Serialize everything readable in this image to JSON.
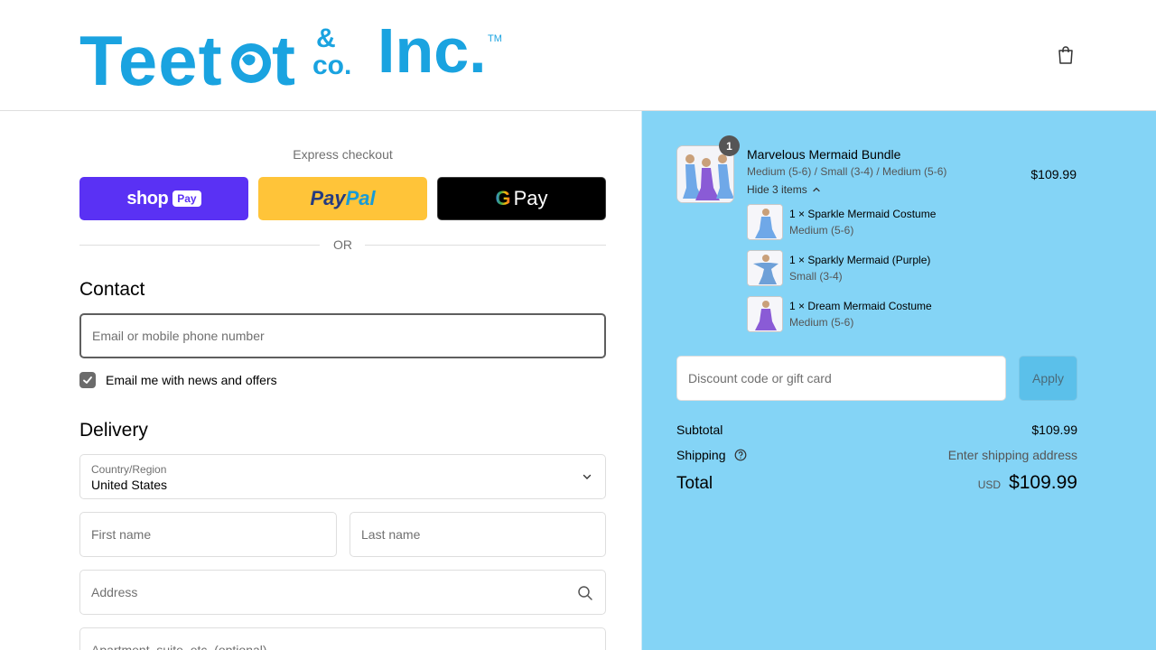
{
  "brand": {
    "logo_text": "Teetot & co. Inc.",
    "colors": {
      "logo": "#1aa3e0",
      "summary_bg": "#84d4f6",
      "shop_pay": "#5a31f4",
      "paypal": "#ffc439"
    }
  },
  "header": {
    "cart_icon": "shopping-bag-icon"
  },
  "express": {
    "label": "Express checkout",
    "shop_text": "shop",
    "shop_pay": "Pay",
    "paypal_1": "Pay",
    "paypal_2": "Pal",
    "gpay_g": "G",
    "gpay_text": "Pay",
    "or": "OR"
  },
  "contact": {
    "title": "Contact",
    "email_placeholder": "Email or mobile phone number",
    "newsletter_label": "Email me with news and offers",
    "newsletter_checked": true
  },
  "delivery": {
    "title": "Delivery",
    "country_label": "Country/Region",
    "country_value": "United States",
    "first_name_placeholder": "First name",
    "last_name_placeholder": "Last name",
    "address_placeholder": "Address",
    "apt_placeholder": "Apartment, suite, etc. (optional)"
  },
  "summary": {
    "product": {
      "qty": "1",
      "name": "Marvelous Mermaid Bundle",
      "variants": "Medium (5-6) / Small (3-4) / Medium (5-6)",
      "price": "$109.99",
      "hide_label": "Hide 3 items"
    },
    "items": [
      {
        "name": "1 × Sparkle Mermaid Costume",
        "variant": "Medium (5-6)"
      },
      {
        "name": "1 × Sparkly Mermaid (Purple)",
        "variant": "Small (3-4)"
      },
      {
        "name": "1 × Dream Mermaid Costume",
        "variant": "Medium (5-6)"
      }
    ],
    "discount_placeholder": "Discount code or gift card",
    "apply_label": "Apply",
    "subtotal_label": "Subtotal",
    "subtotal_value": "$109.99",
    "shipping_label": "Shipping",
    "shipping_value": "Enter shipping address",
    "total_label": "Total",
    "currency": "USD",
    "total_value": "$109.99"
  }
}
